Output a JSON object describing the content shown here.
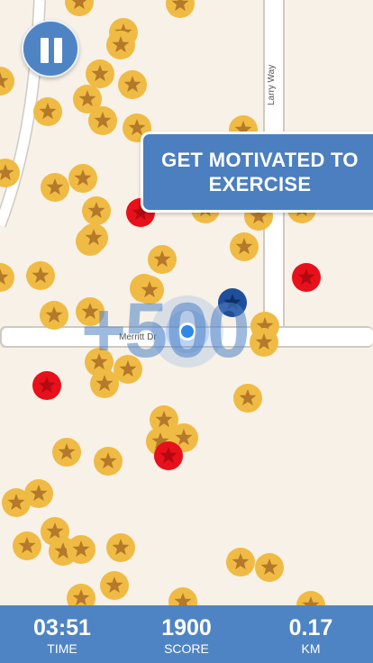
{
  "game": {
    "pause_icon": "pause-icon",
    "banner": {
      "line1": "GET MOTIVATED TO",
      "line2": "EXERCISE"
    },
    "bonus_text": "+500",
    "streets": {
      "merritt": "Merritt Dr",
      "larry": "Larry Way"
    },
    "colors": {
      "coin": "#f0bb44",
      "star": "#b5792b",
      "red_coin": "#e8101a",
      "blue_coin": "#1f4f9a",
      "bar": "#4f84c4",
      "player": "#2f87e6"
    }
  },
  "stats": {
    "time": {
      "value": "03:51",
      "label": "TIME"
    },
    "score": {
      "value": "1900",
      "label": "SCORE"
    },
    "distance": {
      "value": "0.17",
      "label": "KM"
    }
  }
}
